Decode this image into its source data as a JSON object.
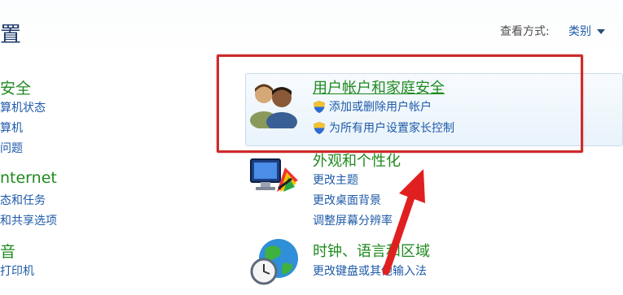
{
  "header": {
    "title_partial": "置",
    "view_mode_label": "查看方式:",
    "view_mode_value": "类别"
  },
  "left_column": {
    "groups": [
      {
        "heading": "安全",
        "links": [
          "算机状态",
          "算机",
          "问题"
        ]
      },
      {
        "heading": "nternet",
        "links": [
          "态和任务",
          "和共享选项"
        ]
      },
      {
        "heading": "音",
        "links": [
          "打印机"
        ]
      }
    ]
  },
  "categories": {
    "user_accounts": {
      "heading": "用户帐户和家庭安全",
      "links": [
        "添加或删除用户帐户",
        "为所有用户设置家长控制"
      ]
    },
    "appearance": {
      "heading": "外观和个性化",
      "links": [
        "更改主题",
        "更改桌面背景",
        "调整屏幕分辨率"
      ]
    },
    "clock_region": {
      "heading": "时钟、语言和区域",
      "links": [
        "更改键盘或其他输入法"
      ]
    }
  },
  "colors": {
    "heading_green": "#1f8a1f",
    "link_blue": "#1e5aa8",
    "annotation_red": "#cf2a2a"
  },
  "annotations": {
    "highlight_box": "red-rectangle",
    "arrow": "red-arrow-pointing-up"
  }
}
